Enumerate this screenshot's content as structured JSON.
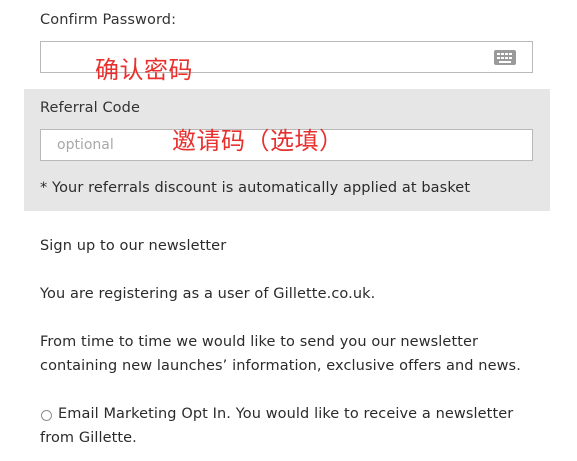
{
  "confirm_password": {
    "label": "Confirm Password:",
    "value": "",
    "annotation": "确认密码"
  },
  "referral": {
    "label": "Referral Code",
    "placeholder": "optional",
    "annotation": "邀请码（选填）",
    "note": "* Your referrals discount is automatically applied at basket"
  },
  "newsletter": {
    "heading": "Sign up to our newsletter",
    "registering_text": "You are registering as a user of Gillette.co.uk.",
    "info_line1": "From time to time we would like to send you our newsletter",
    "info_line2": "containing new launches’ information, exclusive offers and news.",
    "opt_in_line1": "Email Marketing Opt In. You would like to receive a newsletter",
    "opt_in_line2": "from Gillette."
  },
  "colors": {
    "annotation": "#e8312f",
    "panel_background": "#e6e6e6",
    "border": "#b9b9b9"
  },
  "icons": {
    "password_keyboard": "keyboard-icon",
    "opt_in": "radio-button"
  }
}
